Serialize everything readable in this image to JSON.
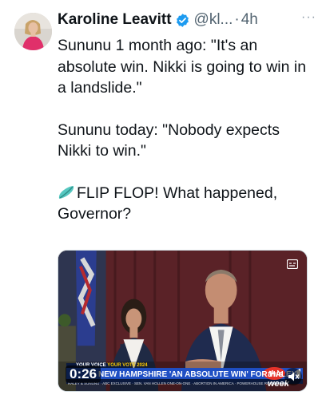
{
  "tweet": {
    "author_name": "Karoline Leavitt",
    "author_handle": "@kl...",
    "separator": "·",
    "timestamp": "4h",
    "more_label": "···",
    "paragraphs": [
      "Sununu 1 month ago: \"It's an absolute win. Nikki is going to win in a landslide.\"",
      "Sununu today: \"Nobody expects Nikki to win.\""
    ],
    "last_paragraph": "FLIP FLOP! What happened, Governor?",
    "emoji": "surfboard-icon"
  },
  "video": {
    "duration": "0:26",
    "strip_white": "YOUR VOICE",
    "strip_yellow": "YOUR VOTE 2024",
    "headline": "NEW HAMPSHIRE 'AN ABSOLUTE WIN' FOR HALEY",
    "ticker": "HALEY & SUNUNU · ABC EXCLUSIVE · SEN. VAN HOLLEN ONE-ON-ONE · ABORTION IN AMERICA · POWERHOUSE ROUNDTABLE",
    "network_logo": "this week"
  },
  "colors": {
    "verified_blue": "#1d9bf0",
    "text": "#0f1419",
    "muted": "#536471",
    "banner_blue": "#1f4fc4"
  }
}
